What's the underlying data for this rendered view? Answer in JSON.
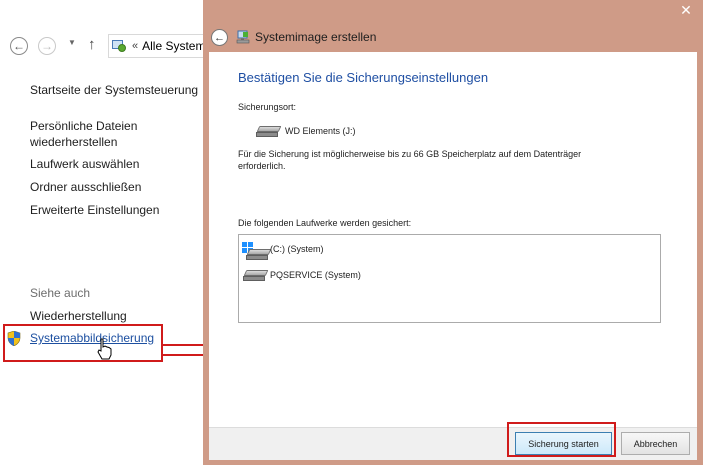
{
  "background_window": {
    "address_sep": "«",
    "address_text": "Alle Systeme",
    "sidebar": {
      "home": "Startseite der Systemsteuerung",
      "restore_files": "Persönliche Dateien wiederherstellen",
      "select_drive": "Laufwerk auswählen",
      "exclude_folders": "Ordner ausschließen",
      "advanced": "Erweiterte Einstellungen",
      "see_also": "Siehe auch",
      "recovery": "Wiederherstellung",
      "system_image_backup": "Systemabbildsicherung"
    }
  },
  "dialog": {
    "close_symbol": "✕",
    "title": "Systemimage erstellen",
    "heading": "Bestätigen Sie die Sicherungseinstellungen",
    "location_label": "Sicherungsort:",
    "location_drive": "WD Elements (J:)",
    "space_note": "Für die Sicherung ist möglicherweise bis zu 66 GB Speicherplatz auf dem Datenträger erforderlich.",
    "drives_label": "Die folgenden Laufwerke werden gesichert:",
    "drives": [
      "(C:) (System)",
      "PQSERVICE (System)"
    ],
    "start_button": "Sicherung starten",
    "cancel_button": "Abbrechen"
  },
  "colors": {
    "dialog_frame": "#cf9b87",
    "heading_blue": "#1f4fa3",
    "highlight_red": "#d01b1b"
  },
  "icons": [
    "back-arrow-icon",
    "forward-arrow-icon",
    "up-arrow-icon",
    "control-panel-icon",
    "shield-icon",
    "hand-cursor-icon",
    "drive-icon",
    "windows-drive-icon",
    "close-icon"
  ]
}
